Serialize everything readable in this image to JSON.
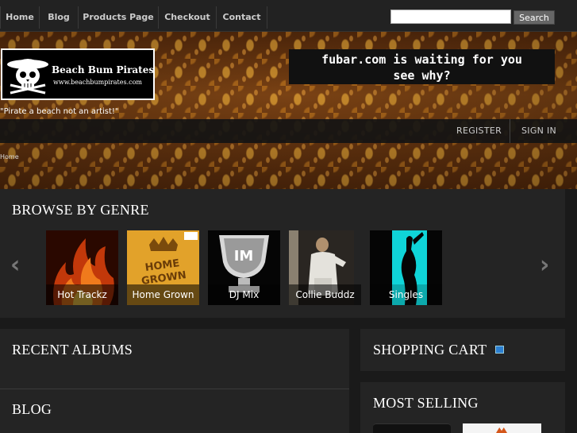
{
  "nav": {
    "items": [
      "Home",
      "Blog",
      "Products Page",
      "Checkout",
      "Contact"
    ],
    "search_button": "Search",
    "search_value": ""
  },
  "header": {
    "logo_title": "Beach Bum Pirates",
    "logo_url": "www.beachbumpirates.com",
    "tagline": "\"Pirate a beach not an artist!\"",
    "promo_line1": "fubar.com is waiting for you",
    "promo_line2": "see why?",
    "register": "REGISTER",
    "sign_in": "SIGN IN",
    "breadcrumb": "Home"
  },
  "genre": {
    "title": "BROWSE BY GENRE",
    "prev_arrow": "‹",
    "next_arrow": "›",
    "items": [
      "Hot Trackz",
      "Home Grown",
      "DJ Mix",
      "Collie Buddz",
      "Singles"
    ]
  },
  "sections": {
    "recent_albums": "RECENT ALBUMS",
    "blog": "BLOG",
    "shopping_cart": "SHOPPING CART",
    "most_selling": "MOST SELLING"
  },
  "colors": {
    "background": "#1a1a1a",
    "panel": "#242424",
    "header_brown": "#6a3510",
    "accent_blue": "#2b7fd1"
  }
}
